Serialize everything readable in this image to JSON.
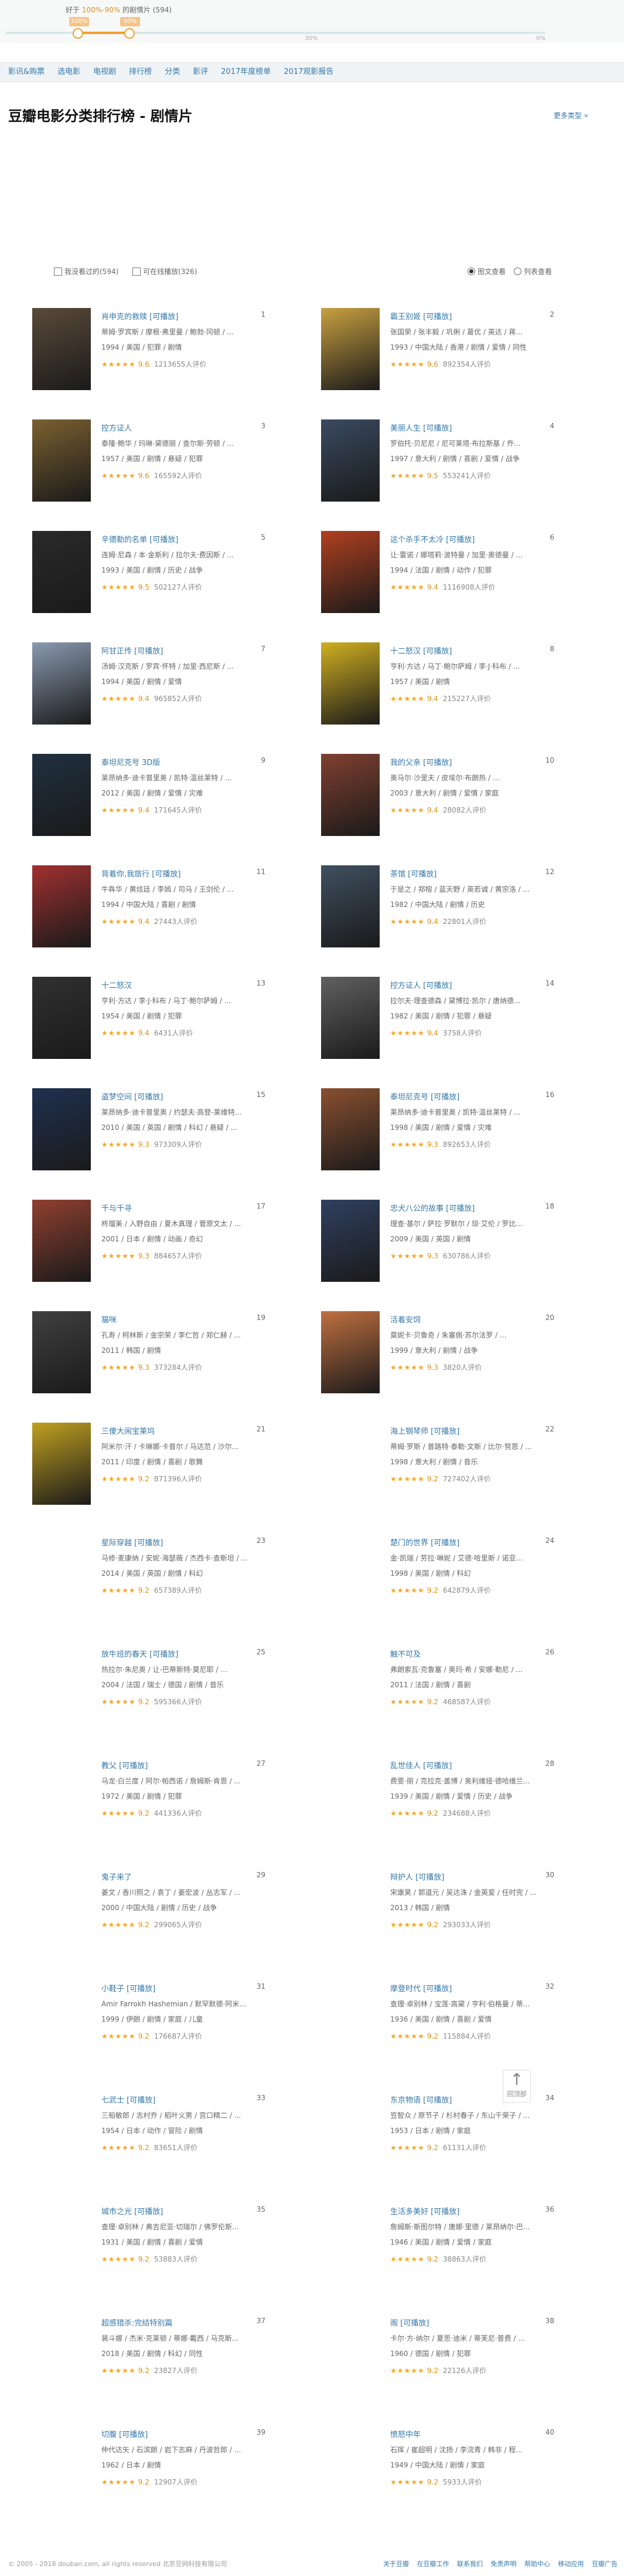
{
  "slider": {
    "prefix": "好于",
    "range": "100%-90%",
    "suffix": "的剧情片 (594)",
    "knob_left_label": "100%",
    "knob_right_label": "90%",
    "marks": [
      "",
      "30%",
      "0%"
    ]
  },
  "nav": [
    "影讯&购票",
    "选电影",
    "电视剧",
    "排行榜",
    "分类",
    "影评",
    "2017年度榜单",
    "2017观影报告"
  ],
  "header": {
    "title": "豆瓣电影分类排行榜 - 剧情片",
    "more": "更多类型 »"
  },
  "filters": {
    "watched": "我没看过的(594)",
    "playable": "可在线播放(326)",
    "view_pic": "图文查看",
    "view_list": "列表查看"
  },
  "movies": [
    {
      "rank": "1",
      "name": "肖申克的救赎 [可播放]",
      "cast": "蒂姆·罗宾斯 / 摩根·弗里曼 / 鲍勃·冈顿 / ...",
      "meta": "1994 / 美国 / 犯罪 / 剧情",
      "rating": "9.6",
      "stars": "★★★★★",
      "votes": "1213655人评价",
      "poster": true
    },
    {
      "rank": "2",
      "name": "霸王别姬 [可播放]",
      "cast": "张国荣 / 张丰毅 / 巩俐 / 葛优 / 英达 / 蒋...",
      "meta": "1993 / 中国大陆 / 香港 / 剧情 / 爱情 / 同性",
      "rating": "9.6",
      "stars": "★★★★★",
      "votes": "892354人评价",
      "poster": true
    },
    {
      "rank": "3",
      "name": "控方证人",
      "cast": "泰隆·鲍华 / 玛琳·黛德丽 / 查尔斯·劳顿 / ...",
      "meta": "1957 / 美国 / 剧情 / 悬疑 / 犯罪",
      "rating": "9.6",
      "stars": "★★★★★",
      "votes": "165592人评价",
      "poster": true
    },
    {
      "rank": "4",
      "name": "美丽人生 [可播放]",
      "cast": "罗伯托·贝尼尼 / 尼可莱塔·布拉斯基 / 乔...",
      "meta": "1997 / 意大利 / 剧情 / 喜剧 / 爱情 / 战争",
      "rating": "9.5",
      "stars": "★★★★★",
      "votes": "553241人评价",
      "poster": true
    },
    {
      "rank": "5",
      "name": "辛德勒的名单 [可播放]",
      "cast": "连姆·尼森 / 本·金斯利 / 拉尔夫·费因斯 / ...",
      "meta": "1993 / 美国 / 剧情 / 历史 / 战争",
      "rating": "9.5",
      "stars": "★★★★★",
      "votes": "502127人评价",
      "poster": true
    },
    {
      "rank": "6",
      "name": "这个杀手不太冷 [可播放]",
      "cast": "让·雷诺 / 娜塔莉·波特曼 / 加里·奥德曼 / ...",
      "meta": "1994 / 法国 / 剧情 / 动作 / 犯罪",
      "rating": "9.4",
      "stars": "★★★★★",
      "votes": "1116908人评价",
      "poster": true
    },
    {
      "rank": "7",
      "name": "阿甘正传 [可播放]",
      "cast": "汤姆·汉克斯 / 罗宾·怀特 / 加里·西尼斯 / ...",
      "meta": "1994 / 美国 / 剧情 / 爱情",
      "rating": "9.4",
      "stars": "★★★★★",
      "votes": "965852人评价",
      "poster": true
    },
    {
      "rank": "8",
      "name": "十二怒汉 [可播放]",
      "cast": "亨利·方达 / 马丁·鲍尔萨姆 / 李·J·科布 / ...",
      "meta": "1957 / 美国 / 剧情",
      "rating": "9.4",
      "stars": "★★★★★",
      "votes": "215227人评价",
      "poster": true
    },
    {
      "rank": "9",
      "name": "泰坦尼克号 3D版",
      "cast": "莱昂纳多·迪卡普里奥 / 凯特·温丝莱特 / ...",
      "meta": "2012 / 美国 / 剧情 / 爱情 / 灾难",
      "rating": "9.4",
      "stars": "★★★★★",
      "votes": "171645人评价",
      "poster": true
    },
    {
      "rank": "10",
      "name": "我的父亲 [可播放]",
      "cast": "奥马尔·沙里夫 / 皮埃尔·布朗热 / ...",
      "meta": "2003 / 意大利 / 剧情 / 爱情 / 家庭",
      "rating": "9.4",
      "stars": "★★★★★",
      "votes": "28082人评价",
      "poster": true
    },
    {
      "rank": "11",
      "name": "背着你,我旅行 [可播放]",
      "cast": "牛犇华 / 黄炫廷 / 李嫣 / 司马 / 王剑伦 / ...",
      "meta": "1994 / 中国大陆 / 喜剧 / 剧情",
      "rating": "9.4",
      "stars": "★★★★★",
      "votes": "27443人评价",
      "poster": true
    },
    {
      "rank": "12",
      "name": "茶馆 [可播放]",
      "cast": "于是之 / 郑榕 / 蓝天野 / 英若诚 / 黄宗洛 / ...",
      "meta": "1982 / 中国大陆 / 剧情 / 历史",
      "rating": "9.4",
      "stars": "★★★★★",
      "votes": "22801人评价",
      "poster": true
    },
    {
      "rank": "13",
      "name": "十二怒汉",
      "cast": "亨利·方达 / 李·J·科布 / 马丁·鲍尔萨姆 / ...",
      "meta": "1954 / 美国 / 剧情 / 犯罪",
      "rating": "9.4",
      "stars": "★★★★★",
      "votes": "6431人评价",
      "poster": true
    },
    {
      "rank": "14",
      "name": "控方证人 [可播放]",
      "cast": "拉尔夫·理查德森 / 黛博拉·凯尔 / 唐纳德...",
      "meta": "1982 / 美国 / 剧情 / 犯罪 / 悬疑",
      "rating": "9.4",
      "stars": "★★★★★",
      "votes": "3758人评价",
      "poster": true
    },
    {
      "rank": "15",
      "name": "盗梦空间 [可播放]",
      "cast": "莱昂纳多·迪卡普里奥 / 约瑟夫·高登-莱维特...",
      "meta": "2010 / 美国 / 英国 / 剧情 / 科幻 / 悬疑 / ...",
      "rating": "9.3",
      "stars": "★★★★★",
      "votes": "973309人评价",
      "poster": true
    },
    {
      "rank": "16",
      "name": "泰坦尼克号 [可播放]",
      "cast": "莱昂纳多·迪卡普里奥 / 凯特·温丝莱特 / ...",
      "meta": "1998 / 美国 / 剧情 / 爱情 / 灾难",
      "rating": "9.3",
      "stars": "★★★★★",
      "votes": "892653人评价",
      "poster": true
    },
    {
      "rank": "17",
      "name": "千与千寻",
      "cast": "柊瑠美 / 入野自由 / 夏木真理 / 菅原文太 / ...",
      "meta": "2001 / 日本 / 剧情 / 动画 / 奇幻",
      "rating": "9.3",
      "stars": "★★★★★",
      "votes": "884657人评价",
      "poster": true
    },
    {
      "rank": "18",
      "name": "忠犬八公的故事 [可播放]",
      "cast": "理查·基尔 / 萨拉·罗默尔 / 琼·艾伦 / 罗比...",
      "meta": "2009 / 美国 / 英国 / 剧情",
      "rating": "9.3",
      "stars": "★★★★★",
      "votes": "630786人评价",
      "poster": true
    },
    {
      "rank": "19",
      "name": "猫咪",
      "cast": "孔寿 / 柯林斯 / 金宗荣 / 李仁哲 / 郑仁赫 / ...",
      "meta": "2011 / 韩国 / 剧情",
      "rating": "9.3",
      "stars": "★★★★★",
      "votes": "373284人评价",
      "poster": true
    },
    {
      "rank": "20",
      "name": "活着安饲",
      "cast": "莫妮卡·贝鲁奇 / 朱塞佩·苏尔法罗 / ...",
      "meta": "1999 / 意大利 / 剧情 / 战争",
      "rating": "9.3",
      "stars": "★★★★★",
      "votes": "3820人评价",
      "poster": true
    },
    {
      "rank": "21",
      "name": "三傻大闹宝莱坞",
      "cast": "阿米尔·汗 / 卡琳娜·卡普尔 / 马达范 / 沙尔...",
      "meta": "2011 / 印度 / 剧情 / 喜剧 / 歌舞",
      "rating": "9.2",
      "stars": "★★★★★",
      "votes": "871396人评价",
      "poster": true
    },
    {
      "rank": "22",
      "name": "海上钢琴师 [可播放]",
      "cast": "蒂姆·罗斯 / 普路特·泰勒·文斯 / 比尔·努恩 / ...",
      "meta": "1998 / 意大利 / 剧情 / 音乐",
      "rating": "9.2",
      "stars": "★★★★★",
      "votes": "727402人评价",
      "poster": false
    },
    {
      "rank": "23",
      "name": "星际穿越 [可播放]",
      "cast": "马修·麦康纳 / 安妮·海瑟薇 / 杰西卡·查斯坦 / ...",
      "meta": "2014 / 美国 / 英国 / 剧情 / 科幻",
      "rating": "9.2",
      "stars": "★★★★★",
      "votes": "657389人评价",
      "poster": false
    },
    {
      "rank": "24",
      "name": "楚门的世界 [可播放]",
      "cast": "金·凯瑞 / 劳拉·琳妮 / 艾德·哈里斯 / 诺亚...",
      "meta": "1998 / 美国 / 剧情 / 科幻",
      "rating": "9.2",
      "stars": "★★★★★",
      "votes": "642879人评价",
      "poster": false
    },
    {
      "rank": "25",
      "name": "放牛班的春天 [可播放]",
      "cast": "热拉尔·朱尼奥 / 让-巴蒂斯特·莫尼耶 / ...",
      "meta": "2004 / 法国 / 瑞士 / 德国 / 剧情 / 音乐",
      "rating": "9.2",
      "stars": "★★★★★",
      "votes": "595366人评价",
      "poster": false
    },
    {
      "rank": "26",
      "name": "触不可及",
      "cast": "弗朗索瓦·克鲁塞 / 奥玛·希 / 安娜·勒尼 / ...",
      "meta": "2011 / 法国 / 剧情 / 喜剧",
      "rating": "9.2",
      "stars": "★★★★★",
      "votes": "468587人评价",
      "poster": false
    },
    {
      "rank": "27",
      "name": "教父 [可播放]",
      "cast": "马龙·白兰度 / 阿尔·帕西诺 / 詹姆斯·肯恩 / ...",
      "meta": "1972 / 美国 / 剧情 / 犯罪",
      "rating": "9.2",
      "stars": "★★★★★",
      "votes": "441336人评价",
      "poster": false
    },
    {
      "rank": "28",
      "name": "乱世佳人 [可播放]",
      "cast": "费雯·丽 / 克拉克·盖博 / 奥利维娅·德哈维兰...",
      "meta": "1939 / 美国 / 剧情 / 爱情 / 历史 / 战争",
      "rating": "9.2",
      "stars": "★★★★★",
      "votes": "234688人评价",
      "poster": false
    },
    {
      "rank": "29",
      "name": "鬼子来了",
      "cast": "姜文 / 香川照之 / 袁丁 / 姜宏波 / 丛志军 / ...",
      "meta": "2000 / 中国大陆 / 剧情 / 历史 / 战争",
      "rating": "9.2",
      "stars": "★★★★★",
      "votes": "299065人评价",
      "poster": false
    },
    {
      "rank": "30",
      "name": "辩护人 [可播放]",
      "cast": "宋康昊 / 郭道元 / 吴达洙 / 金英爱 / 任时完 / ...",
      "meta": "2013 / 韩国 / 剧情",
      "rating": "9.2",
      "stars": "★★★★★",
      "votes": "293033人评价",
      "poster": false
    },
    {
      "rank": "31",
      "name": "小鞋子 [可播放]",
      "cast": "Amir Farrokh Hashemian / 默罕默德·阿米...",
      "meta": "1999 / 伊朗 / 剧情 / 家庭 / 儿童",
      "rating": "9.2",
      "stars": "★★★★★",
      "votes": "176687人评价",
      "poster": false
    },
    {
      "rank": "32",
      "name": "摩登时代 [可播放]",
      "cast": "查理·卓别林 / 宝莲·高黛 / 亨利·伯格曼 / 蒂...",
      "meta": "1936 / 美国 / 剧情 / 喜剧 / 爱情",
      "rating": "9.2",
      "stars": "★★★★★",
      "votes": "115884人评价",
      "poster": false
    },
    {
      "rank": "33",
      "name": "七武士 [可播放]",
      "cast": "三船敏郎 / 志村乔 / 稻叶义男 / 宫口精二 / ...",
      "meta": "1954 / 日本 / 动作 / 冒险 / 剧情",
      "rating": "9.2",
      "stars": "★★★★★",
      "votes": "83651人评价",
      "poster": false
    },
    {
      "rank": "34",
      "name": "东京物语 [可播放]",
      "cast": "笠智众 / 原节子 / 杉村春子 / 东山千荣子 / ...",
      "meta": "1953 / 日本 / 剧情 / 家庭",
      "rating": "9.2",
      "stars": "★★★★★",
      "votes": "61131人评价",
      "poster": false
    },
    {
      "rank": "35",
      "name": "城市之光 [可播放]",
      "cast": "查理·卓别林 / 弗吉尼亚·切瑞尔 / 佛罗伦斯...",
      "meta": "1931 / 美国 / 剧情 / 喜剧 / 爱情",
      "rating": "9.2",
      "stars": "★★★★★",
      "votes": "53883人评价",
      "poster": false
    },
    {
      "rank": "36",
      "name": "生活多美好 [可播放]",
      "cast": "詹姆斯·斯图尔特 / 唐娜·里德 / 莱昂纳尔·巴...",
      "meta": "1946 / 美国 / 剧情 / 爱情 / 家庭",
      "rating": "9.2",
      "stars": "★★★★★",
      "votes": "38863人评价",
      "poster": false
    },
    {
      "rank": "37",
      "name": "超感猎杀:完结特别篇",
      "cast": "裴斗娜 / 杰米·克莱顿 / 蒂娜·戴西 / 马克斯...",
      "meta": "2018 / 美国 / 剧情 / 科幻 / 同性",
      "rating": "9.2",
      "stars": "★★★★★",
      "votes": "23827人评价",
      "poster": false
    },
    {
      "rank": "38",
      "name": "阁 [可播放]",
      "cast": "卡尔·方·纳尔 / 夏思·迪米 / 蒂芙尼·普费 / ...",
      "meta": "1960 / 德国 / 剧情 / 犯罪",
      "rating": "9.2",
      "stars": "★★★★★",
      "votes": "22126人评价",
      "poster": false
    },
    {
      "rank": "39",
      "name": "切腹 [可播放]",
      "cast": "仲代达矢 / 石滨朗 / 岩下志麻 / 丹波哲郎 / ...",
      "meta": "1962 / 日本 / 剧情",
      "rating": "9.2",
      "stars": "★★★★★",
      "votes": "12907人评价",
      "poster": false
    },
    {
      "rank": "40",
      "name": "愤怒中年",
      "cast": "石挥 / 崔超明 / 沈扬 / 李浣青 / 韩非 / 程...",
      "meta": "1949 / 中国大陆 / 剧情 / 家庭",
      "rating": "9.2",
      "stars": "★★★★★",
      "votes": "5933人评价",
      "poster": false
    }
  ],
  "totop": {
    "label": "回顶部"
  },
  "footer": {
    "copyright": "© 2005 - 2018 douban.com, all rights reserved 北京豆网科技有限公司",
    "links": [
      "关于豆瓣",
      "在豆瓣工作",
      "联系我们",
      "免责声明",
      "帮助中心",
      "移动应用",
      "豆瓣广告"
    ]
  }
}
